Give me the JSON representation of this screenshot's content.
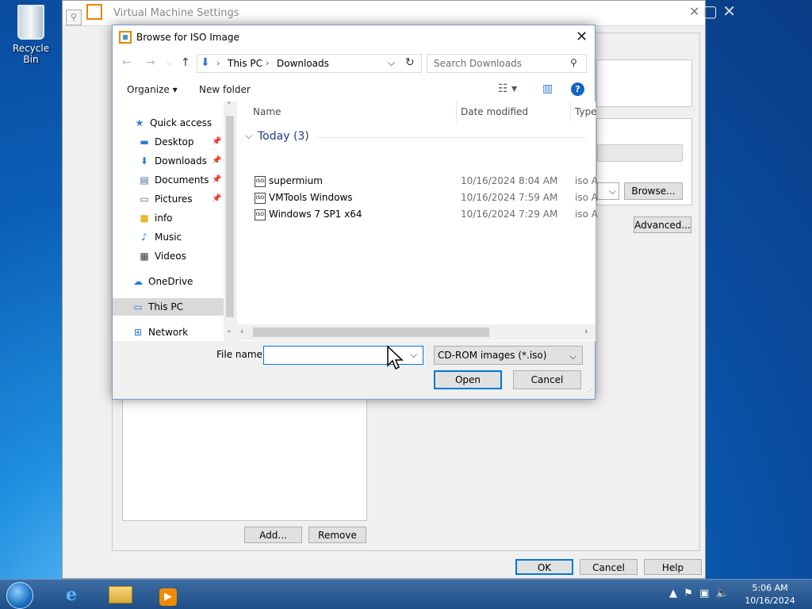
{
  "desktop": {
    "recycle_bin": "Recycle Bin"
  },
  "vm_window": {
    "title": "Virtual Machine Settings",
    "browse_label": "Browse...",
    "advanced_label": "Advanced...",
    "add_label": "Add...",
    "remove_label": "Remove",
    "ok_label": "OK",
    "cancel_label": "Cancel",
    "help_label": "Help"
  },
  "dialog": {
    "title": "Browse for ISO Image",
    "breadcrumb": [
      "This PC",
      "Downloads"
    ],
    "search_placeholder": "Search Downloads",
    "organize_label": "Organize ▾",
    "new_folder_label": "New folder",
    "tree": [
      {
        "label": "Quick access",
        "icon": "star-icon"
      },
      {
        "label": "Desktop",
        "icon": "desktop-icon",
        "pinned": true
      },
      {
        "label": "Downloads",
        "icon": "download-arrow-icon",
        "pinned": true
      },
      {
        "label": "Documents",
        "icon": "documents-icon",
        "pinned": true
      },
      {
        "label": "Pictures",
        "icon": "pictures-icon",
        "pinned": true
      },
      {
        "label": "info",
        "icon": "folder-icon"
      },
      {
        "label": "Music",
        "icon": "music-note-icon"
      },
      {
        "label": "Videos",
        "icon": "film-icon"
      },
      {
        "label": "OneDrive",
        "icon": "cloud-icon"
      },
      {
        "label": "This PC",
        "icon": "computer-icon",
        "selected": true
      },
      {
        "label": "Network",
        "icon": "network-icon"
      }
    ],
    "columns": {
      "name": "Name",
      "date": "Date modified",
      "type": "Type"
    },
    "group_label": "Today (3)",
    "files": [
      {
        "name": "supermium",
        "date": "10/16/2024 8:04 AM",
        "type": "iso A"
      },
      {
        "name": "VMTools Windows",
        "date": "10/16/2024 7:59 AM",
        "type": "iso A"
      },
      {
        "name": "Windows 7 SP1 x64",
        "date": "10/16/2024 7:29 AM",
        "type": "iso A"
      }
    ],
    "file_name_label": "File name:",
    "file_name_value": "",
    "filter_value": "CD-ROM images (*.iso)",
    "open_label": "Open",
    "cancel_label": "Cancel"
  },
  "taskbar": {
    "time": "5:06 AM",
    "date": "10/16/2024"
  },
  "colors": {
    "accent": "#0078d7",
    "taskbar": "#1d4e86"
  }
}
